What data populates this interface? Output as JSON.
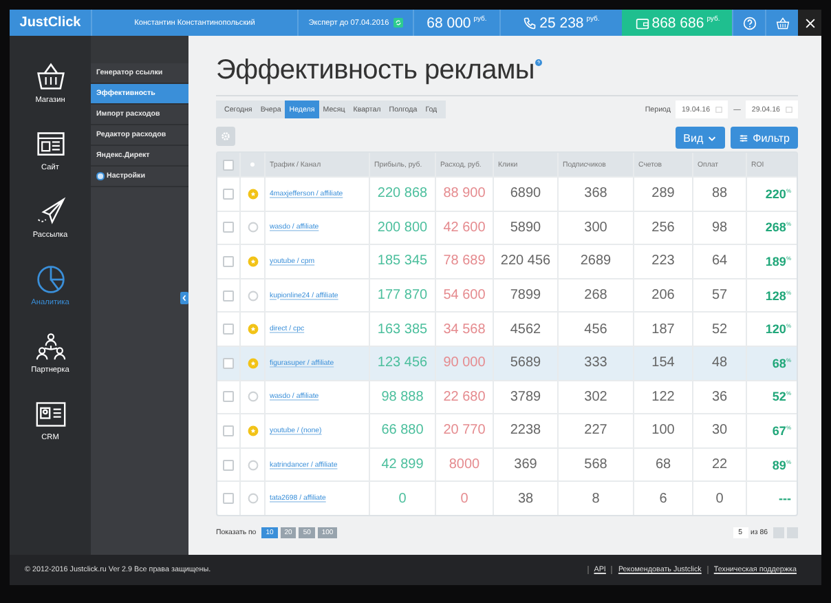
{
  "topbar": {
    "logo": "JustClick",
    "user": "Константин Константинопольский",
    "plan": "Эксперт до 07.04.2016",
    "balances": [
      {
        "kind": "plain",
        "amount": "68 000",
        "currency": "руб."
      },
      {
        "kind": "phone",
        "amount": "25 238",
        "currency": "руб."
      },
      {
        "kind": "wallet",
        "amount": "868 686",
        "currency": "руб."
      }
    ]
  },
  "sidebar": {
    "items": [
      {
        "label": "Магазин",
        "selected": false
      },
      {
        "label": "Сайт",
        "selected": false
      },
      {
        "label": "Рассылка",
        "selected": false
      },
      {
        "label": "Аналитика",
        "selected": true
      },
      {
        "label": "Партнерка",
        "selected": false
      },
      {
        "label": "CRM",
        "selected": false
      }
    ]
  },
  "submenu": {
    "items": [
      {
        "kind": "link",
        "label": "Генератор ссылки",
        "selected": false
      },
      {
        "kind": "link",
        "label": "Эффективность",
        "selected": true
      },
      {
        "kind": "link",
        "label": "Импорт расходов",
        "selected": false
      },
      {
        "kind": "link",
        "label": "Редактор расходов",
        "selected": false
      },
      {
        "kind": "link",
        "label": "Яндекс.Директ",
        "selected": false
      },
      {
        "kind": "dot",
        "label": "Настройки",
        "selected": false
      }
    ]
  },
  "page": {
    "title": "Эффективность рекламы",
    "periods": [
      {
        "label": "Сегодня",
        "selected": false
      },
      {
        "label": "Вчера",
        "selected": false
      },
      {
        "label": "Неделя",
        "selected": true
      },
      {
        "label": "Месяц",
        "selected": false
      },
      {
        "label": "Квартал",
        "selected": false
      },
      {
        "label": "Полгода",
        "selected": false
      },
      {
        "label": "Год",
        "selected": false
      }
    ],
    "period_label": "Период",
    "date_from": "19.04.16",
    "date_separator": "—",
    "date_to": "29.04.16",
    "view_button": "Вид",
    "filter_button": "Фильтр"
  },
  "table": {
    "select_all_checked": false,
    "columns": [
      "Трафик / Канал",
      "Прибыль, руб.",
      "Расход, руб.",
      "Клики",
      "Подписчиков",
      "Счетов",
      "Оплат",
      "ROI"
    ],
    "rows": [
      {
        "checked": false,
        "starred": true,
        "highlighted": false,
        "traffic": "4maxjefferson / affiliate",
        "profit": "220 868",
        "expense": "88 900",
        "clicks": "6890",
        "subscribers": "368",
        "invoices": "289",
        "payments": "88",
        "roi": "220$^{%}$"
      },
      {
        "checked": false,
        "starred": false,
        "highlighted": false,
        "traffic": "wasdo / affiliate",
        "profit": "200 800",
        "expense": "42 600",
        "clicks": "5890",
        "subscribers": "300",
        "invoices": "256",
        "payments": "98",
        "roi": "268$^{%}$"
      },
      {
        "checked": false,
        "starred": true,
        "highlighted": false,
        "traffic": "youtube / cpm",
        "profit": "185 345",
        "expense": "78 689",
        "clicks": "220 456",
        "subscribers": "2689",
        "invoices": "223",
        "payments": "64",
        "roi": "189$^{%}$"
      },
      {
        "checked": false,
        "starred": false,
        "highlighted": false,
        "traffic": "kupionline24 / affiliate",
        "profit": "177 870",
        "expense": "54 600",
        "clicks": "7899",
        "subscribers": "268",
        "invoices": "206",
        "payments": "57",
        "roi": "128$^{%}$"
      },
      {
        "checked": false,
        "starred": true,
        "highlighted": false,
        "traffic": "direct / cpc",
        "profit": "163 385",
        "expense": "34 568",
        "clicks": "4562",
        "subscribers": "456",
        "invoices": "187",
        "payments": "52",
        "roi": "120$^{%}$"
      },
      {
        "checked": false,
        "starred": true,
        "highlighted": true,
        "traffic": "figurasuper / affiliate",
        "profit": "123 456",
        "expense": "90 000",
        "clicks": "5689",
        "subscribers": "333",
        "invoices": "154",
        "payments": "48",
        "roi": "68$^{%}$"
      },
      {
        "checked": false,
        "starred": false,
        "highlighted": false,
        "traffic": "wasdo / affiliate",
        "profit": "98 888",
        "expense": "22 680",
        "clicks": "3789",
        "subscribers": "302",
        "invoices": "122",
        "payments": "36",
        "roi": "52$^{%}$"
      },
      {
        "checked": false,
        "starred": true,
        "highlighted": false,
        "traffic": "youtube / (none)",
        "profit": "66 880",
        "expense": "20 770",
        "clicks": "2238",
        "subscribers": "227",
        "invoices": "100",
        "payments": "30",
        "roi": "67$^{%}$"
      },
      {
        "checked": false,
        "starred": false,
        "highlighted": false,
        "traffic": "katrindancer / affiliate",
        "profit": "42 899",
        "expense": "8000",
        "clicks": "369",
        "subscribers": "568",
        "invoices": "68",
        "payments": "22",
        "roi": "89$^{%}$"
      },
      {
        "checked": false,
        "starred": false,
        "highlighted": false,
        "traffic": "tata2698 / affiliate",
        "profit": "0",
        "expense": "0",
        "clicks": "38",
        "subscribers": "8",
        "invoices": "6",
        "payments": "0",
        "roi": "---"
      }
    ]
  },
  "pagination": {
    "label": "Показать по",
    "sizes": [
      {
        "label": "10",
        "selected": true
      },
      {
        "label": "20",
        "selected": false
      },
      {
        "label": "50",
        "selected": false
      },
      {
        "label": "100",
        "selected": false
      }
    ],
    "page": "5",
    "of_total": "из 86"
  },
  "footer": {
    "copyright": "© 2012-2016 Justclick.ru Ver 2.9 Все права защищены.",
    "links": [
      "API",
      "Рекомендовать Justclick",
      "Техническая поддержка"
    ]
  }
}
